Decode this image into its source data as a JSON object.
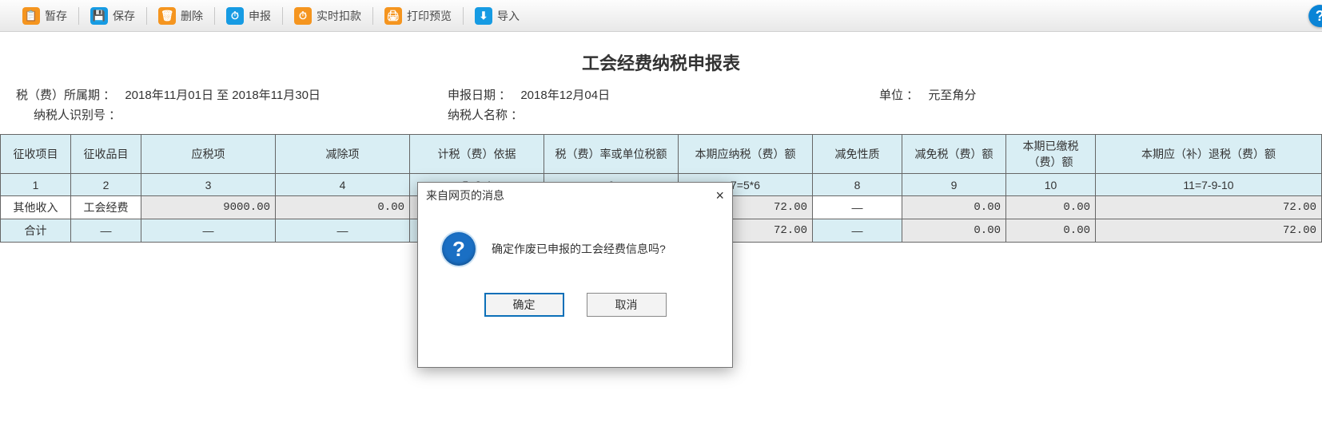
{
  "colors": {
    "orange": "#f5951f",
    "blue": "#169be3",
    "blueDark": "#0b74c8",
    "gray": "#a8a8a8"
  },
  "toolbar": {
    "items": [
      {
        "label": "暂存",
        "icon": "clipboard",
        "color": "orange"
      },
      {
        "label": "保存",
        "icon": "save",
        "color": "blue"
      },
      {
        "label": "删除",
        "icon": "trash",
        "color": "orange"
      },
      {
        "label": "申报",
        "icon": "clock",
        "color": "blue"
      },
      {
        "label": "实时扣款",
        "icon": "clock",
        "color": "orange"
      },
      {
        "label": "打印预览",
        "icon": "printer",
        "color": "orange"
      },
      {
        "label": "导入",
        "icon": "download",
        "color": "blue"
      }
    ],
    "help": "?"
  },
  "page": {
    "title": "工会经费纳税申报表"
  },
  "meta": {
    "periodLabel": "税（费）所属期 ：",
    "periodValue": "2018年11月01日 至 2018年11月30日",
    "declareDateLabel": "申报日期 ：",
    "declareDateValue": "2018年12月04日",
    "unitLabel": "单位 ：",
    "unitValue": "元至角分",
    "taxpayerIdLabel": "纳税人识别号 ：",
    "taxpayerIdValue": "",
    "taxpayerNameLabel": "纳税人名称 ：",
    "taxpayerNameValue": ""
  },
  "table": {
    "headers": [
      "征收项目",
      "征收品目",
      "应税项",
      "减除项",
      "计税（费）依据",
      "税（费）率或单位税额",
      "本期应纳税（费）额",
      "减免性质",
      "减免税（费）额",
      "本期已缴税（费）额",
      "本期应（补）退税（费）额"
    ],
    "formula": [
      "1",
      "2",
      "3",
      "4",
      "5=3-4",
      "6",
      "7=5*6",
      "8",
      "9",
      "10",
      "11=7-9-10"
    ],
    "rows": [
      {
        "c0": "其他收入",
        "c1": "工会经费",
        "c2": "9000.00",
        "c3": "0.00",
        "c4": "",
        "c5": "",
        "c6": "72.00",
        "c7": "—",
        "c8": "0.00",
        "c9": "0.00",
        "c10": "72.00"
      }
    ],
    "totalLabel": "合计",
    "total": {
      "c0": "合计",
      "c1": "—",
      "c2": "—",
      "c3": "—",
      "c4": "",
      "c5": "",
      "c6": "72.00",
      "c7": "—",
      "c8": "0.00",
      "c9": "0.00",
      "c10": "72.00"
    }
  },
  "dialog": {
    "title": "来自网页的消息",
    "message": "确定作废已申报的工会经费信息吗?",
    "ok": "确定",
    "cancel": "取消",
    "close": "×"
  }
}
